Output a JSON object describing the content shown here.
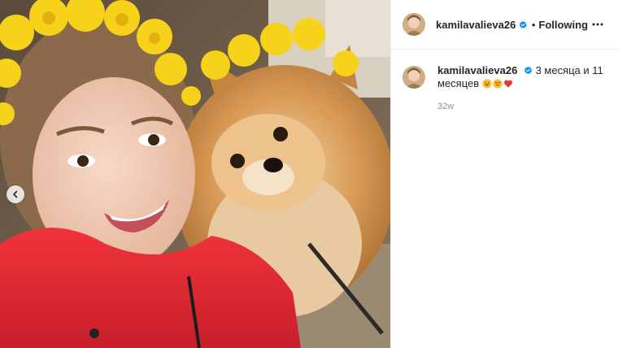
{
  "post": {
    "author": {
      "username": "kamilavalieva26",
      "verified": true
    },
    "header": {
      "separator": "•",
      "follow_label": "Following",
      "more_icon": "more-horizontal-icon"
    },
    "caption": {
      "username": "kamilavalieva26",
      "text": "3 месяца и 11 месяцев",
      "emojis": [
        "grinning-face",
        "heart-eyes-face",
        "red-heart"
      ]
    },
    "timestamp": "32w",
    "carousel": {
      "prev_icon": "chevron-left-icon"
    }
  },
  "colors": {
    "verified_blue": "#0095f6",
    "text_primary": "#262626",
    "text_secondary": "#8e8e8e",
    "divider": "#efefef"
  }
}
